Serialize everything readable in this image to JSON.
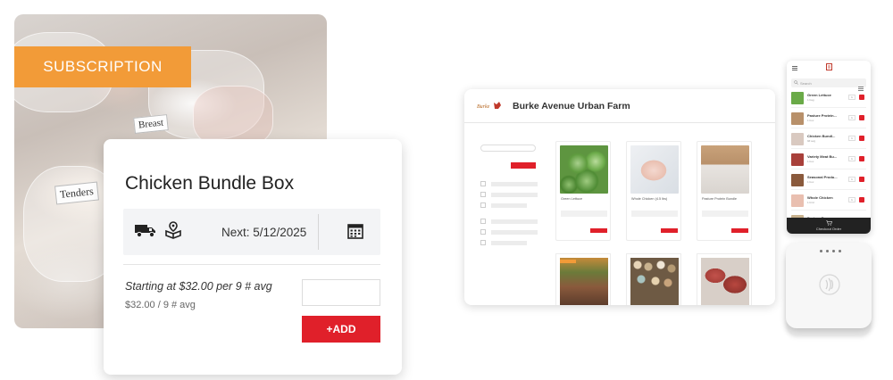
{
  "subscription_panel": {
    "banner": "SUBSCRIPTION",
    "tags": [
      "Breast",
      "Tenders"
    ],
    "banner_color": "#f29b38"
  },
  "product_card": {
    "title": "Chicken Bundle Box",
    "icons": [
      "truck-icon",
      "box-location-icon",
      "calendar-icon"
    ],
    "next_label": "Next: 5/12/2025",
    "price_main": "Starting at $32.00 per 9 # avg",
    "price_sub": "$32.00 / 9 # avg",
    "add_button": "+ADD",
    "accent_color": "#e0202a"
  },
  "storefront": {
    "farm_name": "Burke Avenue Urban Farm",
    "products": [
      {
        "name": "Green Lettuce"
      },
      {
        "name": "Whole Chicken (4.5 lbs)"
      },
      {
        "name": "Pasture Protein Bundle"
      }
    ]
  },
  "mobile": {
    "search_placeholder": "Search",
    "items": [
      {
        "name": "Green Lettuce",
        "sub": "1 bag",
        "qty": "1"
      },
      {
        "name": "Pasture Protein...",
        "sub": "1 box",
        "qty": "1"
      },
      {
        "name": "Chicken Bundl...",
        "sub": "9# avg",
        "qty": "1"
      },
      {
        "name": "Variety Meat Bu...",
        "sub": "1 box",
        "qty": "1"
      },
      {
        "name": "Seasonal Produ...",
        "sub": "1 box",
        "qty": "1"
      },
      {
        "name": "Whole Chicken",
        "sub": "1 bird",
        "qty": "1"
      },
      {
        "name": "Pasture Eggs",
        "sub": "1 doz",
        "qty": "1"
      }
    ],
    "footer": "Checkout Order"
  }
}
